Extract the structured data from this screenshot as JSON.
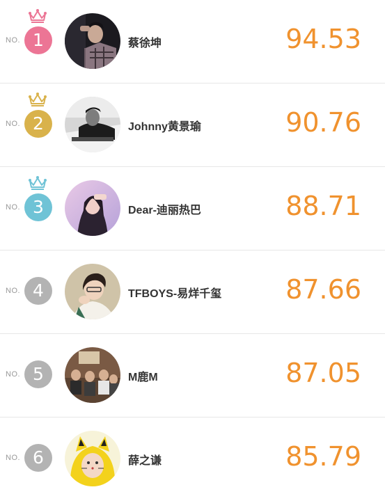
{
  "prefix": "NO.",
  "colors": {
    "rank1": "#ec7595",
    "rank2": "#d9b24b",
    "rank3": "#6fc3d6",
    "rank_other": "#b3b3b3",
    "score": "#f0922e"
  },
  "entries": [
    {
      "rank": "1",
      "name": "蔡徐坤",
      "score": "94.53",
      "crown": "pink-crown-icon"
    },
    {
      "rank": "2",
      "name": "Johnny黄景瑜",
      "score": "90.76",
      "crown": "gold-crown-icon"
    },
    {
      "rank": "3",
      "name": "Dear-迪丽热巴",
      "score": "88.71",
      "crown": "blue-crown-icon"
    },
    {
      "rank": "4",
      "name": "TFBOYS-易烊千玺",
      "score": "87.66"
    },
    {
      "rank": "5",
      "name": "M鹿M",
      "score": "87.05"
    },
    {
      "rank": "6",
      "name": "薛之谦",
      "score": "85.79"
    }
  ]
}
